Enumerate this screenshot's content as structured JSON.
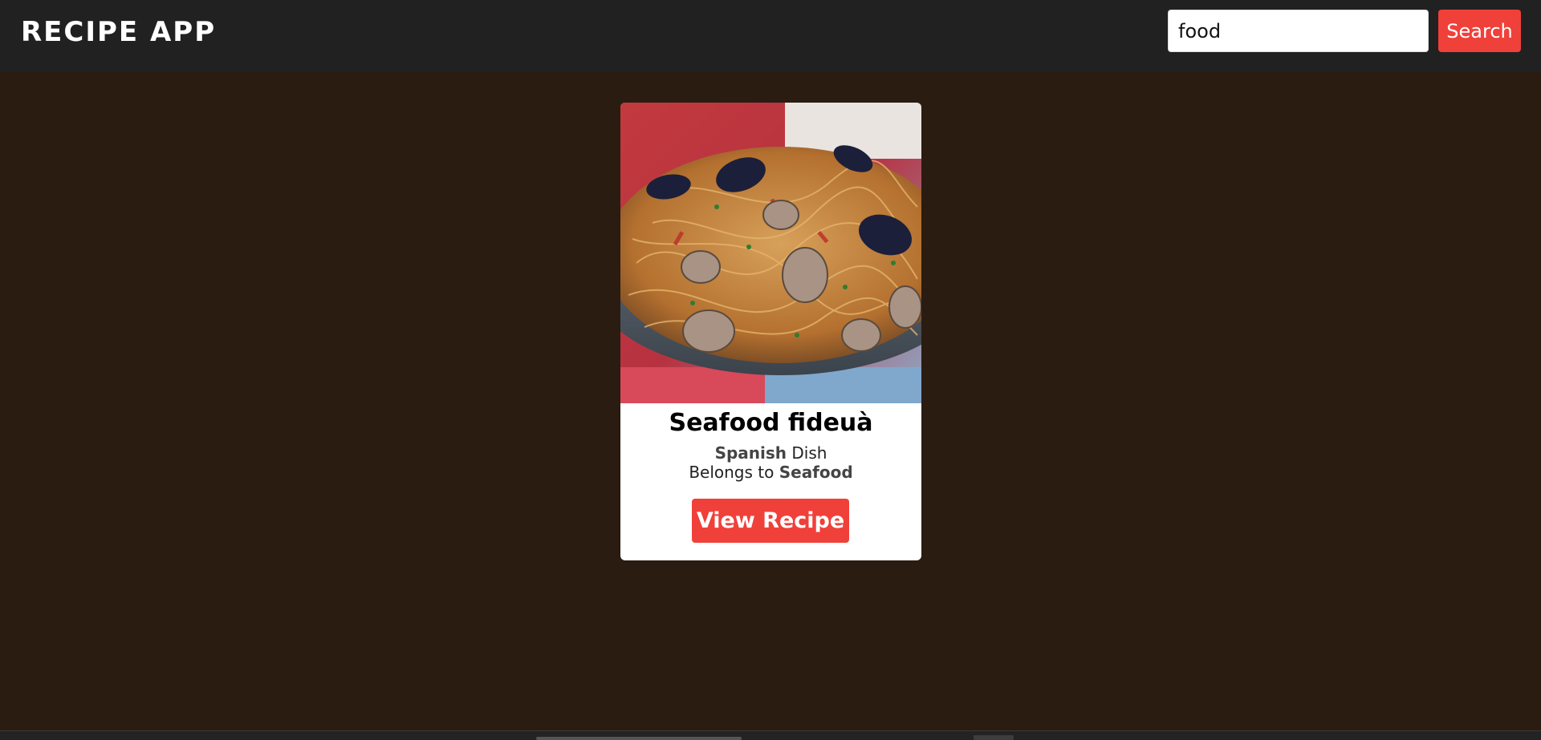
{
  "header": {
    "brand": "RECIPE APP",
    "search_value": "food",
    "search_button_label": "Search"
  },
  "recipe": {
    "title": "Seafood fideuà",
    "area": "Spanish",
    "area_suffix": "Dish",
    "category_prefix": "Belongs to",
    "category": "Seafood",
    "button_label": "View Recipe"
  },
  "colors": {
    "accent": "#f0403a",
    "header_bg": "#212121",
    "page_bg": "#2a1c11",
    "card_bg": "#ffffff"
  }
}
